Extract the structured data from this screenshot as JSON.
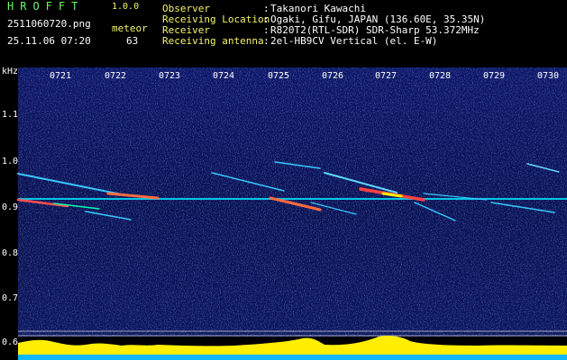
{
  "header": {
    "app_title": "HROFFT",
    "version": "1.0.0",
    "file_name": "2511060720.png",
    "date_time": "25.11.06 07:20",
    "meteor_label": "meteor",
    "meteor_count": "63"
  },
  "info": [
    {
      "key": "Observer",
      "sep": ":",
      "value": "Takanori Kawachi"
    },
    {
      "key": "Receiving Location",
      "sep": ":",
      "value": "Ogaki, Gifu, JAPAN (136.60E, 35.35N)"
    },
    {
      "key": "Receiver",
      "sep": ":",
      "value": "R820T2(RTL-SDR) SDR-Sharp 53.372MHz"
    },
    {
      "key": "Receiving antenna",
      "sep": ":",
      "value": "2el-HB9CV Vertical (el. E-W)"
    }
  ],
  "spectrogram": {
    "y_unit": "kHz",
    "y_ticks": [
      "1.1",
      "1.0",
      "0.9",
      "0.8",
      "0.7",
      "0.6"
    ],
    "x_ticks": [
      "0721",
      "0722",
      "0723",
      "0724",
      "0725",
      "0726",
      "0727",
      "0728",
      "0729",
      "0730"
    ]
  },
  "colors": {
    "label_green": "#6cf56c",
    "label_yellow": "#f5f56c",
    "background": "#0a0f5a",
    "carrier": "#00e5ff",
    "level_bar": "#ffee00"
  }
}
